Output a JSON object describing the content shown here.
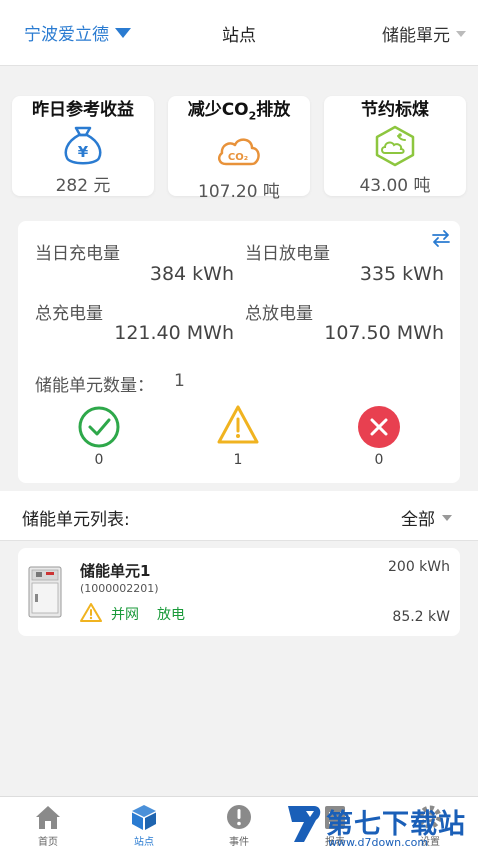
{
  "header": {
    "site_selector": "宁波爱立德",
    "title": "站点",
    "unit_selector": "储能單元"
  },
  "stats": [
    {
      "title_prefix": "昨日参考收益",
      "title_sub": "",
      "title_suffix": "",
      "icon": "money-bag-icon",
      "color": "#2a7bd1",
      "value": "282 元"
    },
    {
      "title_prefix": "减少CO",
      "title_sub": "2",
      "title_suffix": "排放",
      "icon": "co2-cloud-icon",
      "color": "#e8923a",
      "value": "107.20 吨"
    },
    {
      "title_prefix": "节约标煤",
      "title_sub": "",
      "title_suffix": "",
      "icon": "coal-icon",
      "color": "#8dc63f",
      "value": "43.00 吨"
    }
  ],
  "summary": {
    "daily_charge_label": "当日充电量",
    "daily_charge_value": "384 kWh",
    "daily_discharge_label": "当日放电量",
    "daily_discharge_value": "335 kWh",
    "total_charge_label": "总充电量",
    "total_charge_value": "121.40 MWh",
    "total_discharge_label": "总放电量",
    "total_discharge_value": "107.50 MWh",
    "unit_count_label": "储能单元数量：",
    "unit_count_value": "1",
    "status": [
      {
        "icon": "check-circle-icon",
        "color": "#2ea84a",
        "count": "0"
      },
      {
        "icon": "warning-icon",
        "color": "#f0b320",
        "count": "1"
      },
      {
        "icon": "error-circle-icon",
        "color": "#e84050",
        "count": "0"
      }
    ]
  },
  "list": {
    "title": "储能单元列表:",
    "filter": "全部"
  },
  "units": [
    {
      "name": "储能单元1",
      "id": "(1000002201)",
      "grid_status": "并网",
      "mode": "放电",
      "capacity": "200 kWh",
      "power": "85.2 kW"
    }
  ],
  "nav": [
    {
      "label": "首页",
      "icon": "home-icon",
      "active": false
    },
    {
      "label": "站点",
      "icon": "cube-icon",
      "active": true
    },
    {
      "label": "事件",
      "icon": "alert-icon",
      "active": false
    },
    {
      "label": "报表",
      "icon": "report-icon",
      "active": false
    },
    {
      "label": "设置",
      "icon": "settings-icon",
      "active": false
    }
  ],
  "watermark": {
    "text": "第七下载站",
    "url": "www.d7down.com"
  },
  "colors": {
    "accent": "#2a7bd1",
    "ok": "#2ea84a",
    "warn": "#f0b320",
    "error": "#e84050"
  }
}
